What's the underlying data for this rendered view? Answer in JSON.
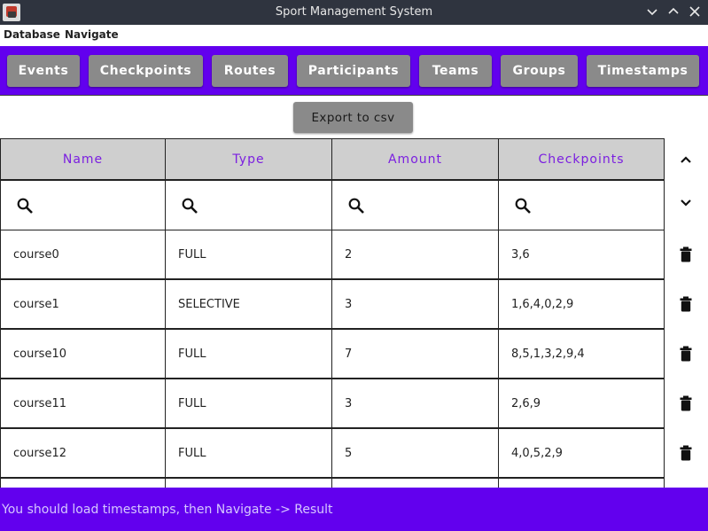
{
  "window": {
    "title": "Sport Management System"
  },
  "menu": {
    "items": [
      "Database",
      "Navigate"
    ]
  },
  "nav": {
    "buttons": [
      "Events",
      "Checkpoints",
      "Routes",
      "Participants",
      "Teams",
      "Groups",
      "Timestamps"
    ]
  },
  "export": {
    "label": "Export to csv"
  },
  "table": {
    "columns": [
      "Name",
      "Type",
      "Amount",
      "Checkpoints"
    ],
    "rows": [
      [
        "course0",
        "FULL",
        "2",
        "3,6"
      ],
      [
        "course1",
        "SELECTIVE",
        "3",
        "1,6,4,0,2,9"
      ],
      [
        "course10",
        "FULL",
        "7",
        "8,5,1,3,2,9,4"
      ],
      [
        "course11",
        "FULL",
        "3",
        "2,6,9"
      ],
      [
        "course12",
        "FULL",
        "5",
        "4,0,5,2,9"
      ],
      [
        "",
        "",
        "",
        ""
      ]
    ]
  },
  "icons": {
    "filter": "search-icon",
    "row_action": "trash-icon",
    "scroll_up": "chevron-up-icon",
    "scroll_down": "chevron-down-icon"
  },
  "colors": {
    "accent": "#6200ee",
    "header_text": "#7b1fe0",
    "button": "#8a8a8a",
    "titlebar": "#2f343f"
  },
  "status": {
    "message": "You should load timestamps, then Navigate -> Result"
  }
}
